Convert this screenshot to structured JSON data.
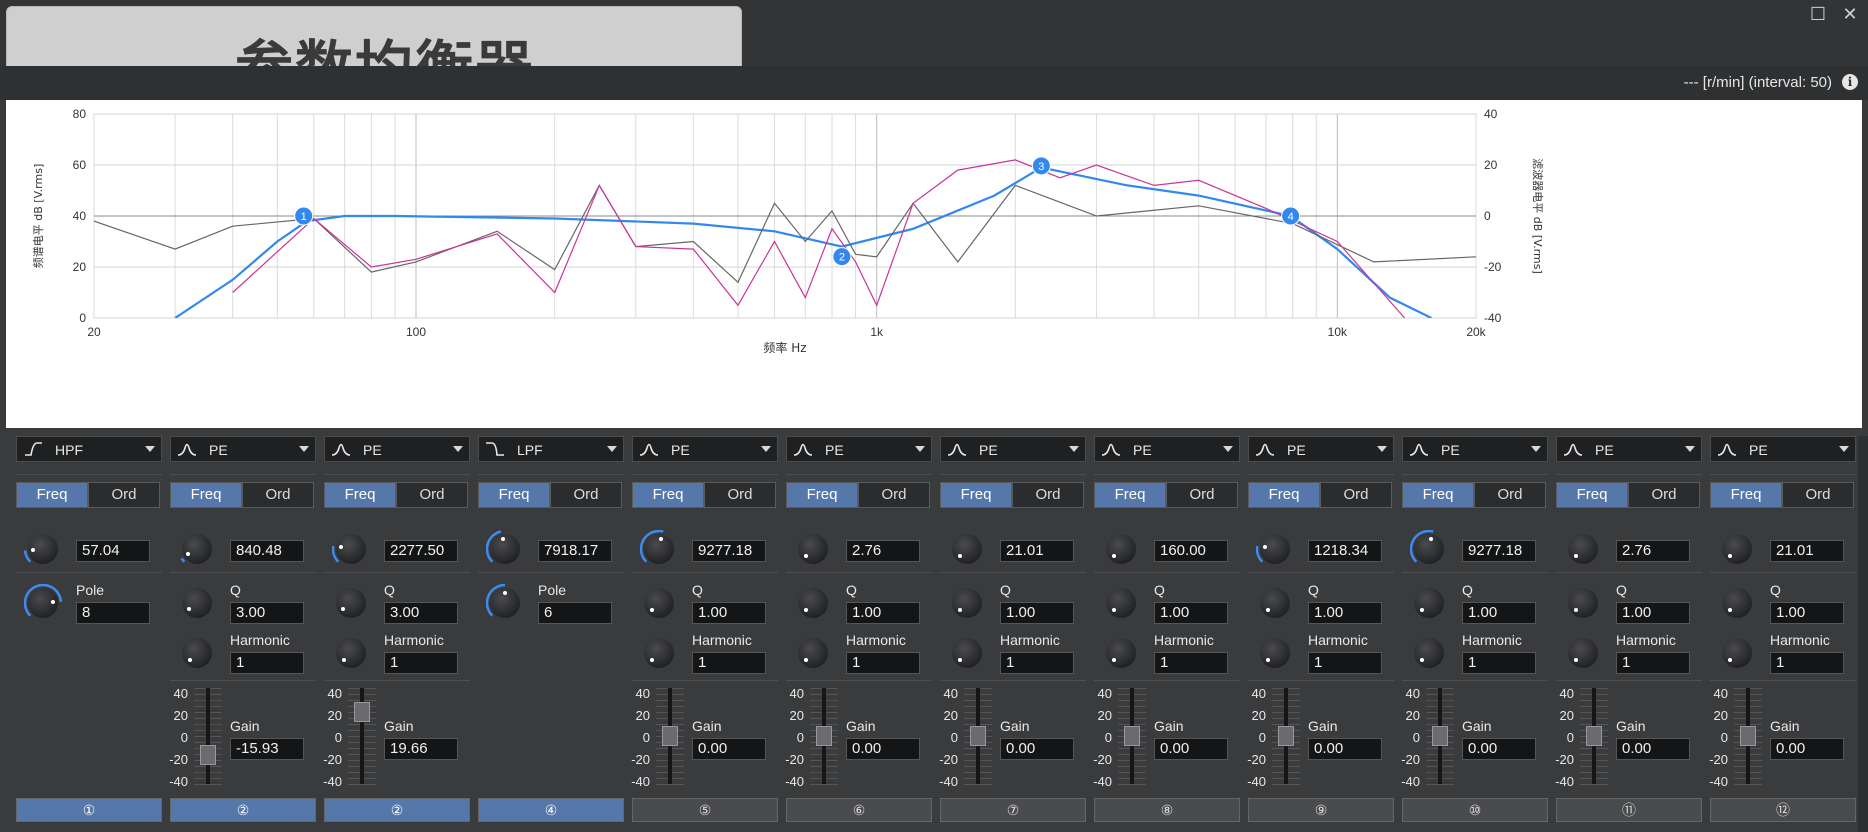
{
  "title": "参数均衡器",
  "status_text": "--- [r/min] (interval: 50)",
  "info_icon": "i",
  "window": {
    "maximize_icon": "☐",
    "close_icon": "✕"
  },
  "chart_data": {
    "type": "line",
    "xlabel": "频率 Hz",
    "ylabel_left": "频谱电平 dB [V.rms]",
    "ylabel_right": "滤波器电平 dB [V.rms]",
    "x_scale": "log",
    "xlim": [
      20,
      20000
    ],
    "x_ticks": [
      "20",
      "100",
      "1k",
      "10k",
      "20k"
    ],
    "ylim_left": [
      0,
      80
    ],
    "y_ticks_left": [
      "80",
      "60",
      "40",
      "20",
      "0"
    ],
    "ylim_right": [
      -40,
      40
    ],
    "y_ticks_right": [
      "40",
      "20",
      "0",
      "-20",
      "-40"
    ],
    "grid": true,
    "series": [
      {
        "color": "#3388ee",
        "x": [
          30,
          40,
          50,
          58,
          70,
          90,
          200,
          400,
          600,
          840,
          1200,
          1800,
          2278,
          3500,
          5000,
          7918,
          10000,
          13000,
          16000
        ],
        "y": [
          -40,
          -25,
          -10,
          -2,
          0,
          0,
          -1,
          -3,
          -6,
          -12,
          -5,
          8,
          19,
          12,
          8,
          0,
          -13,
          -32,
          -40
        ]
      },
      {
        "color": "#666666",
        "x": [
          20,
          30,
          40,
          60,
          80,
          100,
          150,
          200,
          250,
          300,
          400,
          500,
          600,
          700,
          800,
          900,
          1000,
          1200,
          1500,
          2000,
          3000,
          5000,
          8000,
          12000,
          20000
        ],
        "y": [
          38,
          27,
          36,
          39,
          18,
          22,
          34,
          19,
          52,
          28,
          30,
          14,
          45,
          30,
          42,
          25,
          24,
          45,
          22,
          52,
          40,
          44,
          37,
          22,
          24
        ]
      },
      {
        "color": "#cc3399",
        "x": [
          40,
          60,
          80,
          100,
          150,
          200,
          250,
          300,
          400,
          500,
          600,
          700,
          800,
          900,
          1000,
          1200,
          1500,
          2000,
          2500,
          3000,
          4000,
          5000,
          7000,
          10000,
          14000
        ],
        "y": [
          10,
          39,
          20,
          23,
          33,
          10,
          52,
          28,
          27,
          5,
          30,
          8,
          35,
          22,
          5,
          45,
          58,
          62,
          55,
          60,
          52,
          54,
          43,
          30,
          0
        ]
      }
    ],
    "points": [
      {
        "label": "1",
        "x": 57.04,
        "y": 0
      },
      {
        "label": "2",
        "x": 840.48,
        "y": -15.93
      },
      {
        "label": "3",
        "x": 2277.5,
        "y": 19.66
      },
      {
        "label": "4",
        "x": 7918.17,
        "y": 0
      }
    ]
  },
  "channels": [
    {
      "type": "HPF",
      "icon": "hpf-icon",
      "freq_active": true,
      "freq": "57.04",
      "second_label": "Pole",
      "second_value": "8",
      "has_harmonic": false,
      "has_gain": false,
      "btn": "①",
      "btn_on": true,
      "knob1": 0.15,
      "knob2": 0.82
    },
    {
      "type": "PE",
      "icon": "peak-icon",
      "freq_active": true,
      "freq": "840.48",
      "second_label": "Q",
      "second_value": "3.00",
      "has_harmonic": true,
      "harmonic": "1",
      "has_gain": true,
      "gain": "-15.93",
      "gain_pos": -15.93,
      "btn": "②",
      "btn_on": true,
      "knob1": 0.05,
      "knob2": 0.02
    },
    {
      "type": "PE",
      "icon": "peak-icon",
      "freq_active": true,
      "freq": "2277.50",
      "second_label": "Q",
      "second_value": "3.00",
      "has_harmonic": true,
      "harmonic": "1",
      "has_gain": true,
      "gain": "19.66",
      "gain_pos": 19.66,
      "btn": "②",
      "btn_on": true,
      "knob1": 0.2,
      "knob2": 0.02
    },
    {
      "type": "LPF",
      "icon": "lpf-icon",
      "freq_active": true,
      "freq": "7918.17",
      "second_label": "Pole",
      "second_value": "6",
      "has_harmonic": false,
      "has_gain": false,
      "btn": "④",
      "btn_on": true,
      "knob1": 0.45,
      "knob2": 0.5
    },
    {
      "type": "PE",
      "icon": "peak-icon",
      "freq_active": true,
      "freq": "9277.18",
      "second_label": "Q",
      "second_value": "1.00",
      "has_harmonic": true,
      "harmonic": "1",
      "has_gain": true,
      "gain": "0.00",
      "gain_pos": 0,
      "btn": "⑤",
      "btn_on": false,
      "knob1": 0.55,
      "knob2": 0
    },
    {
      "type": "PE",
      "icon": "peak-icon",
      "freq_active": true,
      "freq": "2.76",
      "second_label": "Q",
      "second_value": "1.00",
      "has_harmonic": true,
      "harmonic": "1",
      "has_gain": true,
      "gain": "0.00",
      "gain_pos": 0,
      "btn": "⑥",
      "btn_on": false,
      "knob1": 0,
      "knob2": 0
    },
    {
      "type": "PE",
      "icon": "peak-icon",
      "freq_active": true,
      "freq": "21.01",
      "second_label": "Q",
      "second_value": "1.00",
      "has_harmonic": true,
      "harmonic": "1",
      "has_gain": true,
      "gain": "0.00",
      "gain_pos": 0,
      "btn": "⑦",
      "btn_on": false,
      "knob1": 0,
      "knob2": 0
    },
    {
      "type": "PE",
      "icon": "peak-icon",
      "freq_active": true,
      "freq": "160.00",
      "second_label": "Q",
      "second_value": "1.00",
      "has_harmonic": true,
      "harmonic": "1",
      "has_gain": true,
      "gain": "0.00",
      "gain_pos": 0,
      "btn": "⑧",
      "btn_on": false,
      "knob1": 0,
      "knob2": 0
    },
    {
      "type": "PE",
      "icon": "peak-icon",
      "freq_active": true,
      "freq": "1218.34",
      "second_label": "Q",
      "second_value": "1.00",
      "has_harmonic": true,
      "harmonic": "1",
      "has_gain": true,
      "gain": "0.00",
      "gain_pos": 0,
      "btn": "⑨",
      "btn_on": false,
      "knob1": 0.2,
      "knob2": 0
    },
    {
      "type": "PE",
      "icon": "peak-icon",
      "freq_active": true,
      "freq": "9277.18",
      "second_label": "Q",
      "second_value": "1.00",
      "has_harmonic": true,
      "harmonic": "1",
      "has_gain": true,
      "gain": "0.00",
      "gain_pos": 0,
      "btn": "⑩",
      "btn_on": false,
      "knob1": 0.55,
      "knob2": 0
    },
    {
      "type": "PE",
      "icon": "peak-icon",
      "freq_active": true,
      "freq": "2.76",
      "second_label": "Q",
      "second_value": "1.00",
      "has_harmonic": true,
      "harmonic": "1",
      "has_gain": true,
      "gain": "0.00",
      "gain_pos": 0,
      "btn": "⑪",
      "btn_on": false,
      "knob1": 0,
      "knob2": 0
    },
    {
      "type": "PE",
      "icon": "peak-icon",
      "freq_active": true,
      "freq": "21.01",
      "second_label": "Q",
      "second_value": "1.00",
      "has_harmonic": true,
      "harmonic": "1",
      "has_gain": true,
      "gain": "0.00",
      "gain_pos": 0,
      "btn": "⑫",
      "btn_on": false,
      "knob1": 0,
      "knob2": 0
    }
  ],
  "labels": {
    "freq": "Freq",
    "ord": "Ord",
    "harmonic": "Harmonic",
    "gain": "Gain",
    "gain_scale": [
      "40",
      "20",
      "0",
      "-20",
      "-40"
    ]
  },
  "colors": {
    "accent": "#5577aa",
    "curve": "#3388ee",
    "spectrum1": "#666666",
    "spectrum2": "#cc3399"
  }
}
